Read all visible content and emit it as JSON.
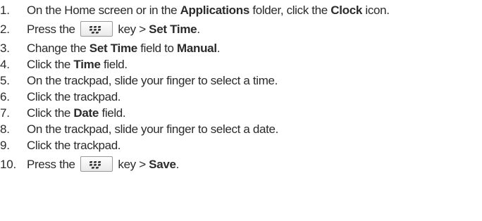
{
  "steps": [
    {
      "number": "1.",
      "parts": {
        "a": "On the Home screen or in the ",
        "b": "Applications",
        "c": " folder, click the ",
        "d": "Clock",
        "e": " icon."
      }
    },
    {
      "number": "2.",
      "parts": {
        "a": "Press the ",
        "b": " key > ",
        "c": "Set Time",
        "d": "."
      }
    },
    {
      "number": "3.",
      "parts": {
        "a": "Change the ",
        "b": "Set Time",
        "c": " field to ",
        "d": "Manual",
        "e": "."
      }
    },
    {
      "number": "4.",
      "parts": {
        "a": "Click the ",
        "b": "Time",
        "c": " field."
      }
    },
    {
      "number": "5.",
      "parts": {
        "a": "On the trackpad, slide your finger to select a time."
      }
    },
    {
      "number": "6.",
      "parts": {
        "a": "Click the trackpad."
      }
    },
    {
      "number": "7.",
      "parts": {
        "a": "Click the ",
        "b": "Date",
        "c": " field."
      }
    },
    {
      "number": "8.",
      "parts": {
        "a": "On the trackpad, slide your finger to select a date."
      }
    },
    {
      "number": "9.",
      "parts": {
        "a": "Click the trackpad."
      }
    },
    {
      "number": "10.",
      "parts": {
        "a": "Press the ",
        "b": " key > ",
        "c": "Save",
        "d": "."
      }
    }
  ],
  "icons": {
    "menu_key": "blackberry-menu-key-icon"
  }
}
